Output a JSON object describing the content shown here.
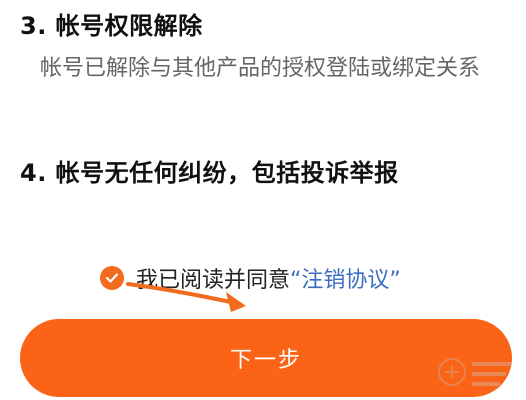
{
  "sections": [
    {
      "title": "3. 帐号权限解除",
      "description": "帐号已解除与其他产品的授权登陆或绑定关系"
    },
    {
      "title": "4. 帐号无任何纠纷，包括投诉举报"
    }
  ],
  "agreement": {
    "text": "我已阅读并同意",
    "link": "“注销协议”",
    "checked": true
  },
  "next_button": {
    "label": "下一步"
  },
  "colors": {
    "accent": "#fb6417",
    "link": "#3b6cc4",
    "arrow": "#f26a1b"
  },
  "icons": [
    "check-icon",
    "annotation-arrow-icon",
    "watermark-icon"
  ]
}
